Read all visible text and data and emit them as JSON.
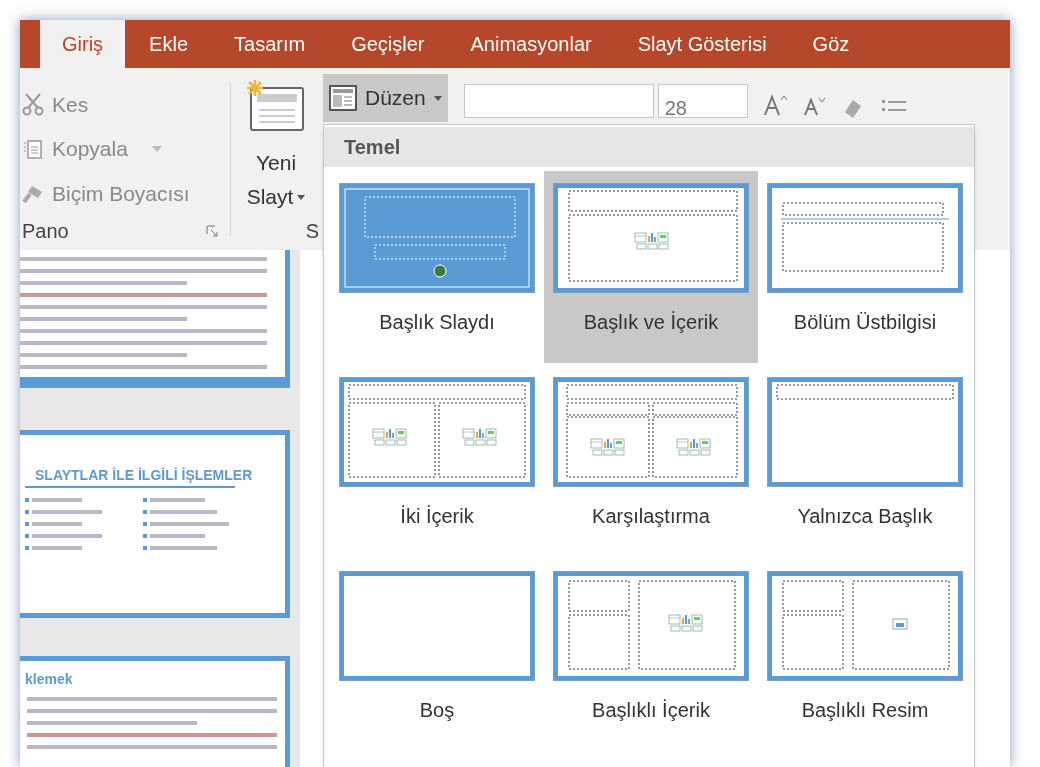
{
  "tabs": [
    {
      "label": "Giriş",
      "selected": true
    },
    {
      "label": "Ekle",
      "selected": false
    },
    {
      "label": "Tasarım",
      "selected": false
    },
    {
      "label": "Geçişler",
      "selected": false
    },
    {
      "label": "Animasyonlar",
      "selected": false
    },
    {
      "label": "Slayt Gösterisi",
      "selected": false
    },
    {
      "label": "Göz",
      "selected": false
    }
  ],
  "clipboard": {
    "items": [
      {
        "kind": "cut",
        "label": "Kes",
        "disabled": true
      },
      {
        "kind": "copy",
        "label": "Kopyala",
        "disabled": true
      },
      {
        "kind": "painter",
        "label": "Biçim Boyacısı",
        "disabled": true
      }
    ],
    "group_label": "Pano"
  },
  "new_slide": {
    "line1": "Yeni",
    "line2": "Slayt"
  },
  "slides_group_label": "S",
  "layout_button": {
    "label": "Düzen",
    "pressed": true
  },
  "font_size": "28",
  "layout_menu": {
    "section": "Temel",
    "layouts": [
      {
        "kind": "title",
        "name": "Başlık Slaydı",
        "selected": false
      },
      {
        "kind": "title_content",
        "name": "Başlık ve İçerik",
        "selected": true
      },
      {
        "kind": "section",
        "name": "Bölüm Üstbilgisi",
        "selected": false
      },
      {
        "kind": "two_content",
        "name": "İki İçerik",
        "selected": false
      },
      {
        "kind": "comparison",
        "name": "Karşılaştırma",
        "selected": false
      },
      {
        "kind": "title_only",
        "name": "Yalnızca Başlık",
        "selected": false
      },
      {
        "kind": "blank",
        "name": "Boş",
        "selected": false
      },
      {
        "kind": "content_caption",
        "name": "Başlıklı İçerik",
        "selected": false
      },
      {
        "kind": "picture_caption",
        "name": "Başlıklı Resim",
        "selected": false
      }
    ]
  },
  "slides": [
    {
      "kind": "text"
    },
    {
      "kind": "title_list",
      "title": "SLAYTLAR İLE İLGİLİ İŞLEMLER"
    },
    {
      "kind": "heading_text",
      "title": "klemek"
    }
  ]
}
